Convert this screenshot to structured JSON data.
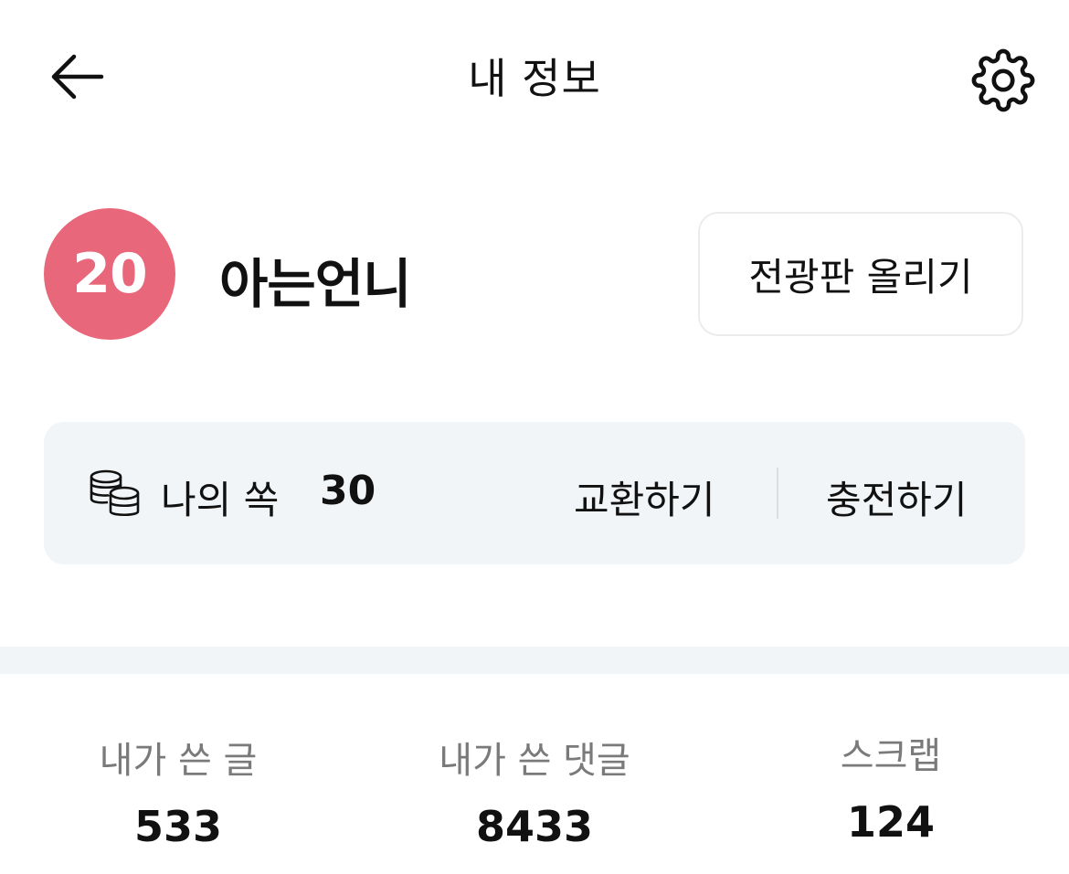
{
  "header": {
    "title": "내 정보",
    "back_icon": "arrow-left-icon",
    "settings_icon": "gear-icon"
  },
  "profile": {
    "age_badge": "20",
    "age_badge_color": "#e8677a",
    "nickname": "아는언니",
    "board_button_label": "전광판 올리기"
  },
  "coins": {
    "icon": "coins-icon",
    "label": "나의 쏙",
    "value": "30",
    "exchange_label": "교환하기",
    "charge_label": "충전하기"
  },
  "stats": [
    {
      "label": "내가 쓴 글",
      "value": "533"
    },
    {
      "label": "내가 쓴 댓글",
      "value": "8433"
    },
    {
      "label": "스크랩",
      "value": "124"
    }
  ],
  "colors": {
    "panel_background": "#f2f5f7",
    "muted_text": "#7a7a7a"
  }
}
